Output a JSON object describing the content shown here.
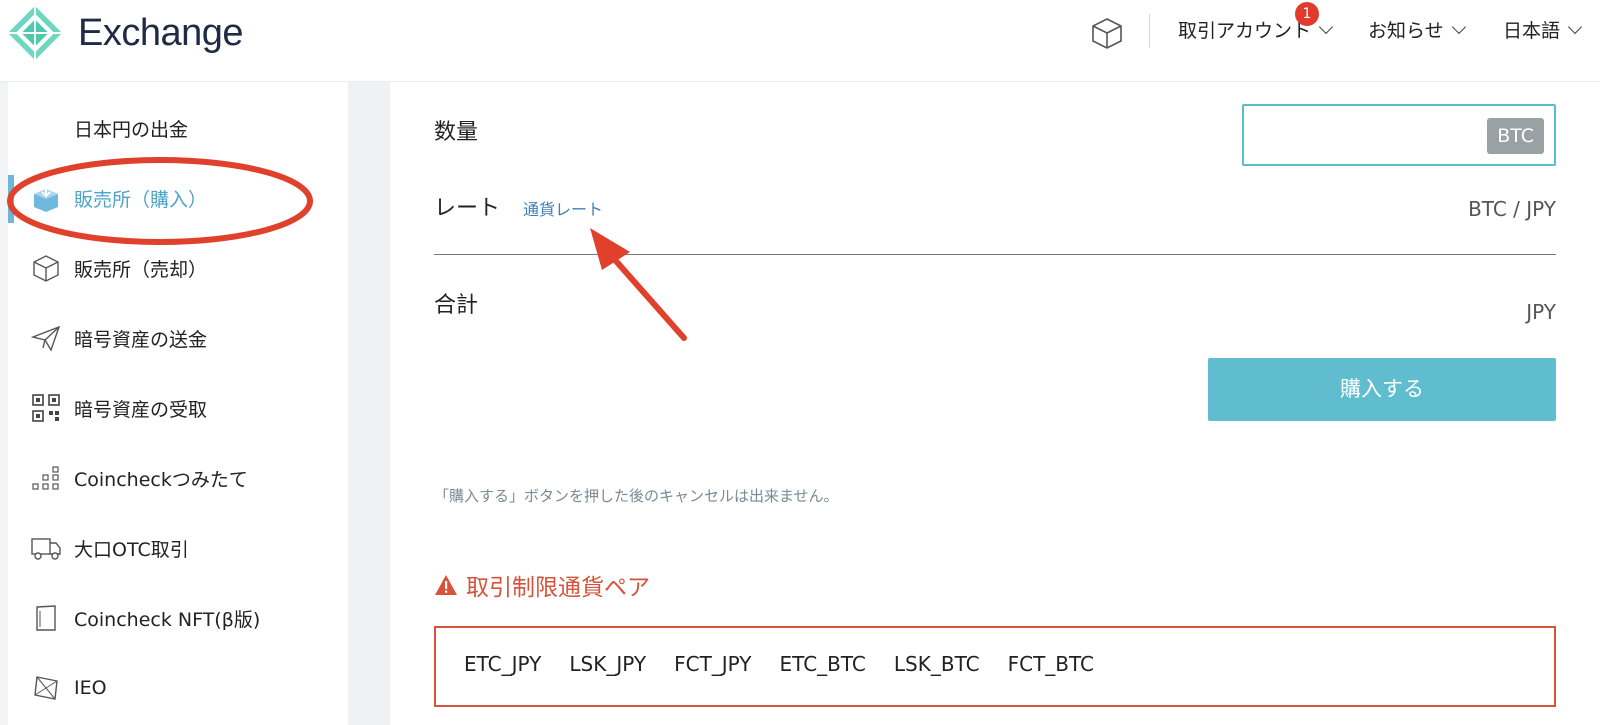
{
  "header": {
    "brand": "Exchange",
    "menu": [
      {
        "label": "取引アカウント",
        "badge": "1"
      },
      {
        "label": "お知らせ"
      },
      {
        "label": "日本語"
      }
    ]
  },
  "sidebar": {
    "items": [
      {
        "label": "日本円の出金",
        "icon": "none"
      },
      {
        "label": "販売所（購入）",
        "icon": "box-download-icon",
        "active": true
      },
      {
        "label": "販売所（売却）",
        "icon": "cube-icon"
      },
      {
        "label": "暗号資産の送金",
        "icon": "paper-plane-icon"
      },
      {
        "label": "暗号資産の受取",
        "icon": "qr-code-icon"
      },
      {
        "label": "Coincheckつみたて",
        "icon": "dots-stack-icon"
      },
      {
        "label": "大口OTC取引",
        "icon": "truck-icon"
      },
      {
        "label": "Coincheck NFT(β版)",
        "icon": "card-icon"
      },
      {
        "label": "IEO",
        "icon": "gem-icon"
      }
    ]
  },
  "main": {
    "quantity_label": "数量",
    "quantity_value": "",
    "quantity_unit": "BTC",
    "rate_label": "レート",
    "rate_link": "通貨レート",
    "rate_pair": "BTC / JPY",
    "total_label": "合計",
    "total_unit": "JPY",
    "buy_button": "購入する",
    "notice": "「購入する」ボタンを押した後のキャンセルは出来ません。",
    "warning_title": "取引制限通貨ペア",
    "restricted_pairs": [
      "ETC_JPY",
      "LSK_JPY",
      "FCT_JPY",
      "ETC_BTC",
      "LSK_BTC",
      "FCT_BTC"
    ]
  },
  "colors": {
    "accent": "#5fbdcf",
    "active_nav": "#4ea3c9",
    "warning": "#d6533c",
    "annotation": "#e0412d"
  }
}
